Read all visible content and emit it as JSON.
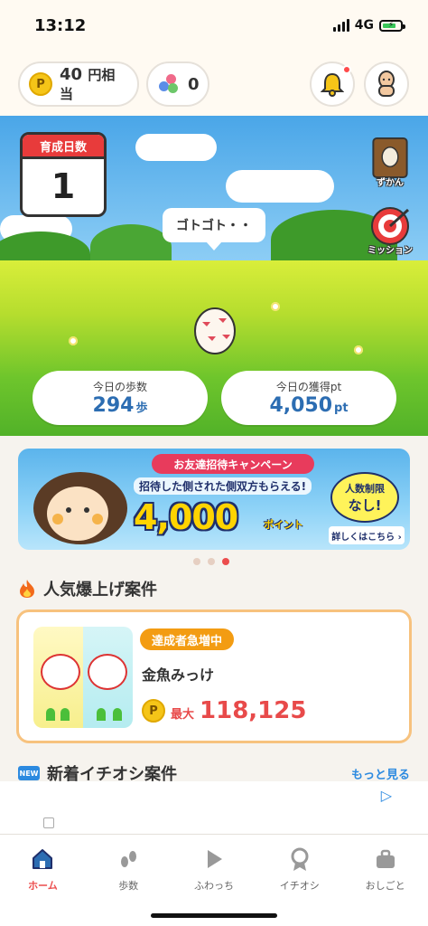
{
  "status_bar": {
    "time": "13:12",
    "network": "4G"
  },
  "header": {
    "points_value": "40",
    "points_unit": "円相当",
    "points_symbol": "P",
    "gems_count": "0"
  },
  "hero": {
    "days_label": "育成日数",
    "days_value": "1",
    "speech": "ゴトゴト・・",
    "zukan_label": "ずかん",
    "mission_label": "ミッション",
    "steps_label": "今日の歩数",
    "steps_value": "294",
    "steps_unit": "歩",
    "points_label": "今日の獲得pt",
    "points_value": "4,050",
    "points_unit": "pt"
  },
  "banner": {
    "ribbon": "お友達招待キャンペーン",
    "subtitle": "招待した側された側双方もらえる!",
    "amount": "4,000",
    "amount_unit": "ポイント",
    "limit_line1": "人数制限",
    "limit_line2": "なし!",
    "link": "詳しくはこちら ›"
  },
  "carousel": {
    "count": 3,
    "active_index": 2
  },
  "popular": {
    "title": "人気爆上げ案件",
    "tag": "達成者急増中",
    "name": "金魚みっけ",
    "reward_prefix": "最大",
    "reward_value": "118,125",
    "coin_symbol": "P"
  },
  "new_section": {
    "title": "新着イチオシ案件",
    "new_tag": "NEW",
    "more": "もっと見る"
  },
  "tabs": [
    {
      "label": "ホーム",
      "icon": "home-icon",
      "active": true
    },
    {
      "label": "歩数",
      "icon": "footprints-icon",
      "active": false
    },
    {
      "label": "ふわっち",
      "icon": "play-icon",
      "active": false
    },
    {
      "label": "イチオシ",
      "icon": "medal-icon",
      "active": false
    },
    {
      "label": "おしごと",
      "icon": "briefcase-icon",
      "active": false
    }
  ],
  "colors": {
    "accent_red": "#ec4d4d",
    "accent_blue": "#2c6db2",
    "card_border": "#f7c27e",
    "tag_orange": "#f39c12"
  }
}
